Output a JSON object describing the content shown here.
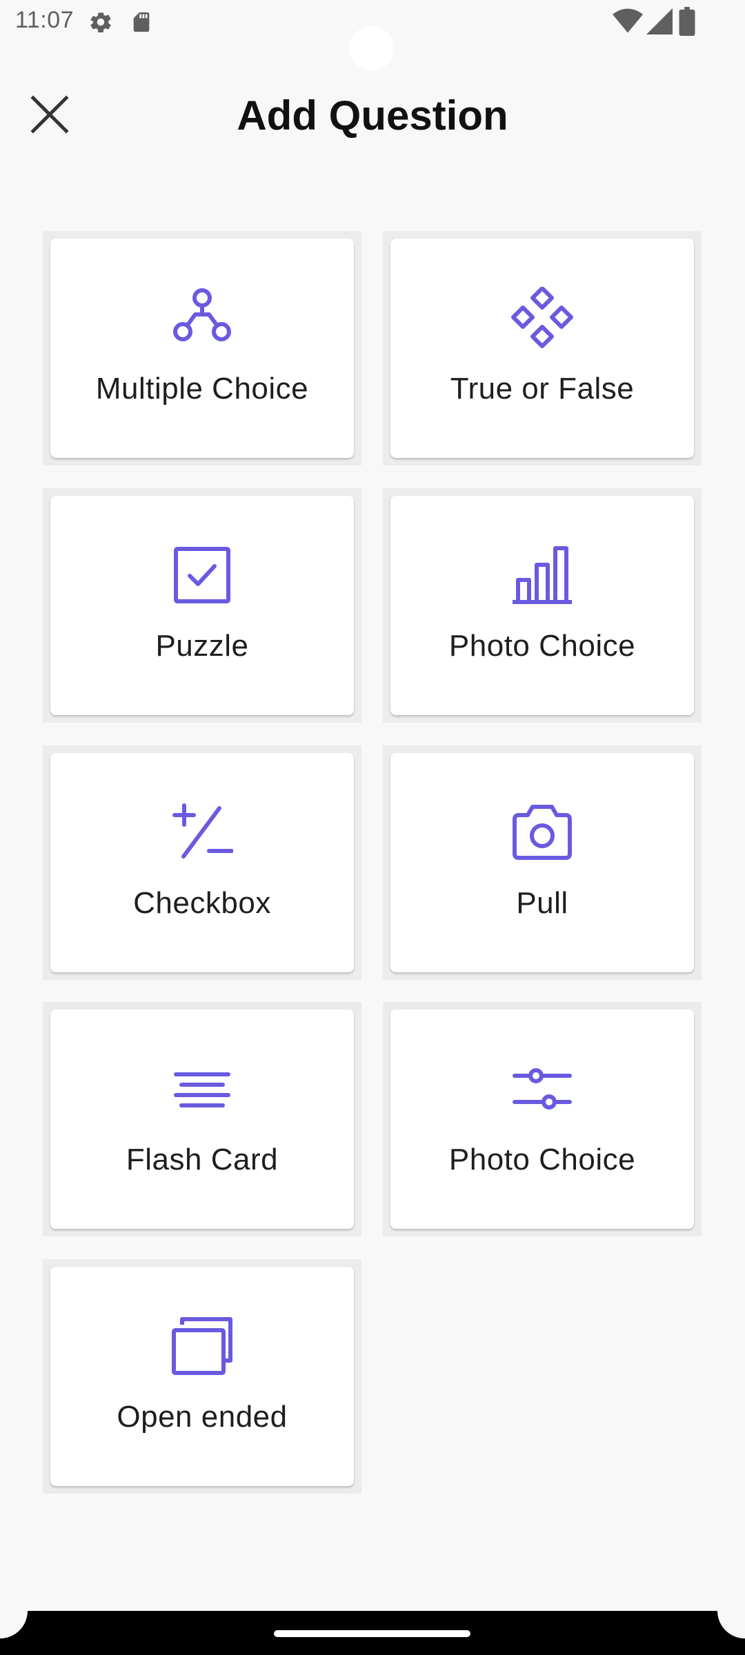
{
  "status_bar": {
    "time": "11:07",
    "left_icons": [
      "gear-icon",
      "sd-card-icon"
    ],
    "right_icons": [
      "wifi-icon",
      "signal-icon",
      "battery-icon"
    ]
  },
  "header": {
    "title": "Add Question",
    "close_icon": "close-icon"
  },
  "accent_color": "#6a5ae0",
  "question_types": [
    {
      "label": "Multiple Choice",
      "icon": "hierarchy-icon"
    },
    {
      "label": "True or False",
      "icon": "diamonds-icon"
    },
    {
      "label": "Puzzle",
      "icon": "check-square-icon"
    },
    {
      "label": "Photo Choice",
      "icon": "bar-chart-icon"
    },
    {
      "label": "Checkbox",
      "icon": "plus-minus-icon"
    },
    {
      "label": "Pull",
      "icon": "camera-icon"
    },
    {
      "label": "Flash Card",
      "icon": "text-lines-icon"
    },
    {
      "label": "Photo Choice",
      "icon": "sliders-icon"
    },
    {
      "label": "Open ended",
      "icon": "stacked-windows-icon"
    }
  ]
}
